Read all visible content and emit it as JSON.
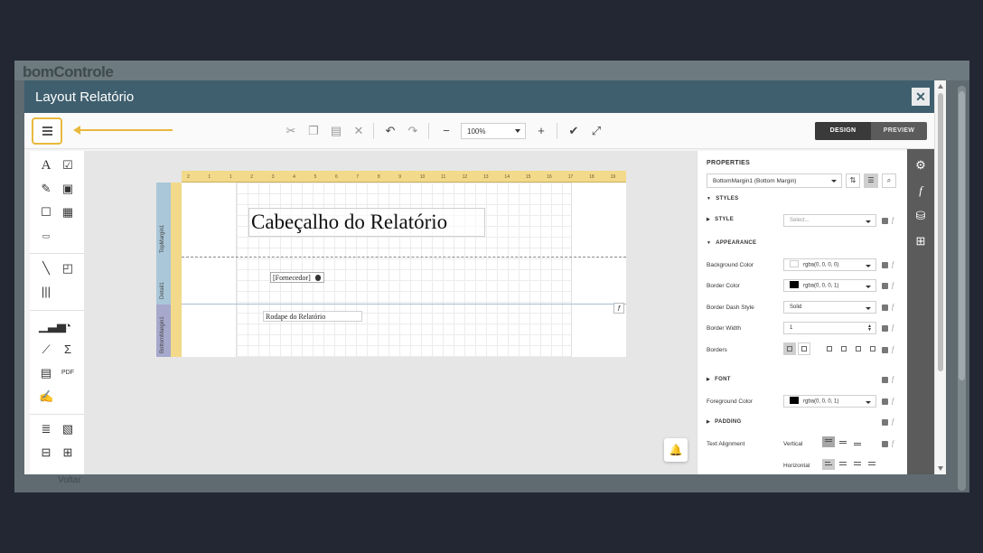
{
  "background_app": {
    "logo": "bomControle",
    "back_label": "Voltar"
  },
  "modal": {
    "title": "Layout Relatório",
    "close_label": "✕"
  },
  "toolbar": {
    "zoom": "100%",
    "mode_design": "DESIGN",
    "mode_preview": "PREVIEW",
    "icons": [
      "cut-icon",
      "copy-icon",
      "paste-icon",
      "delete-icon",
      "undo-icon",
      "redo-icon",
      "zoom-out-icon",
      "zoom-in-icon",
      "validate-icon",
      "fullscreen-icon"
    ]
  },
  "report": {
    "ruler_numbers": [
      "2",
      "1",
      "1",
      "2",
      "3",
      "4",
      "5",
      "6",
      "7",
      "8",
      "9",
      "10",
      "11",
      "12",
      "13",
      "14",
      "15",
      "16",
      "17",
      "18",
      "19"
    ],
    "bands": {
      "top": "TopMargin1",
      "detail": "Detail1",
      "bottom": "BottomMargin1"
    },
    "header_text": "Cabeçalho do Relatório",
    "field_text": "[Fornecedor]",
    "footer_text": "Rodape do Relatório",
    "fx": "f"
  },
  "properties": {
    "title": "PROPERTIES",
    "component": "BottomMargin1 (Bottom Margin)",
    "styles_section": "STYLES",
    "style_label": "STYLE",
    "style_placeholder": "Select...",
    "appearance_section": "APPEARANCE",
    "background_color_label": "Background Color",
    "background_color_value": "rgba(0, 0, 0, 0)",
    "border_color_label": "Border Color",
    "border_color_value": "rgba(0, 0, 0, 1)",
    "border_dash_label": "Border Dash Style",
    "border_dash_value": "Solid",
    "border_width_label": "Border Width",
    "border_width_value": "1",
    "borders_label": "Borders",
    "font_section": "FONT",
    "foreground_color_label": "Foreground Color",
    "foreground_color_value": "rgba(0, 0, 0, 1)",
    "padding_section": "PADDING",
    "text_alignment_label": "Text Alignment",
    "vertical_label": "Vertical",
    "horizontal_label": "Horizontal"
  },
  "colors": {
    "header": "#3f5f6e",
    "highlight": "#e9b93e",
    "ruler": "#f3d98a",
    "band_tab": "#a9c7d8"
  }
}
